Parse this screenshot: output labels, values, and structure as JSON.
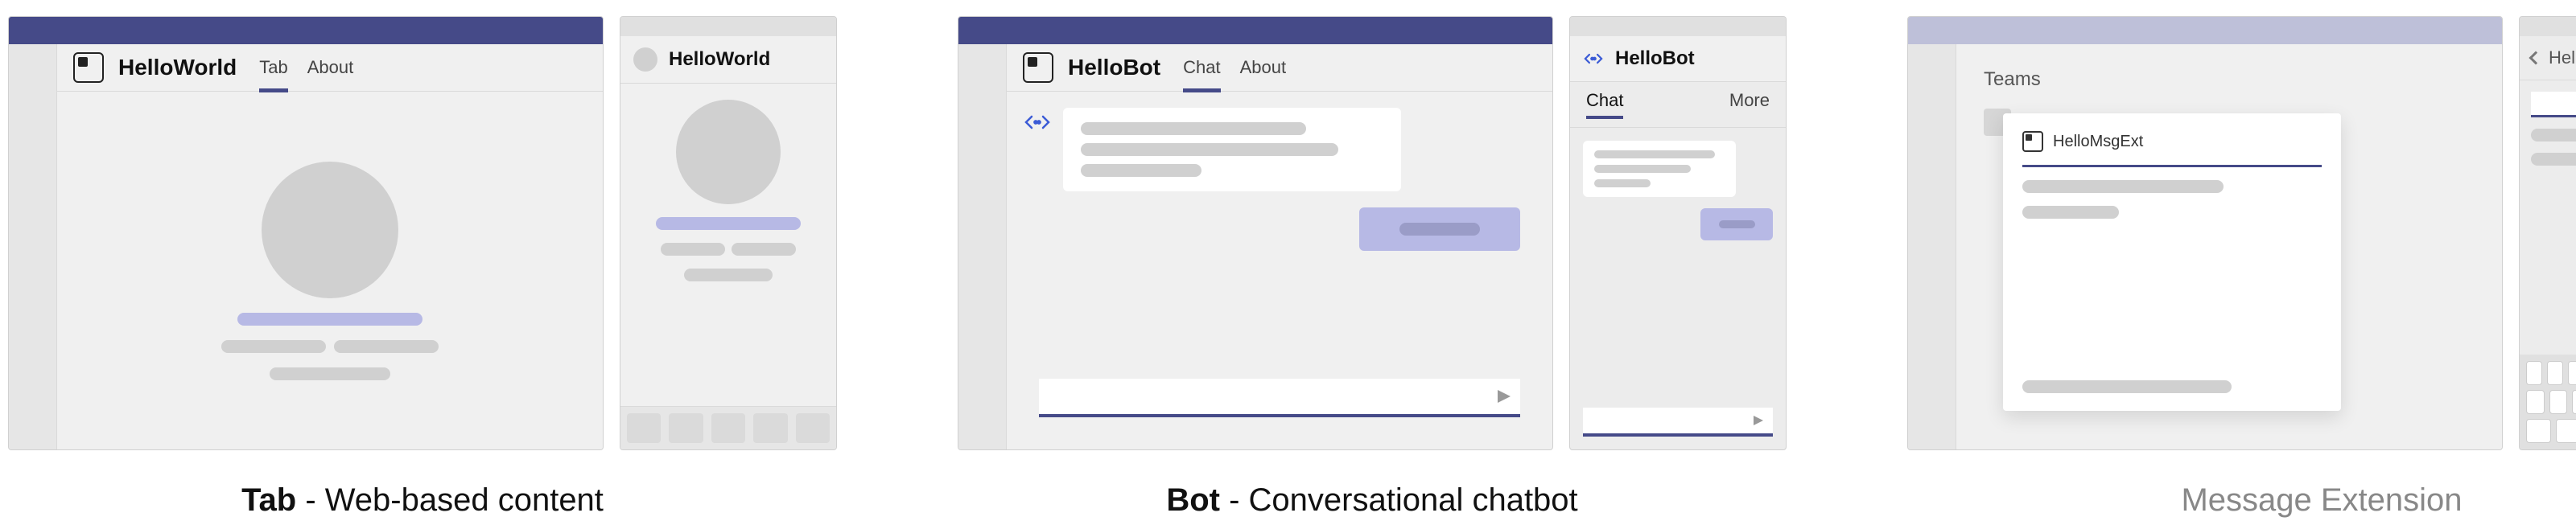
{
  "tab_group": {
    "app_name": "HelloWorld",
    "tabs": [
      "Tab",
      "About"
    ],
    "mobile_title": "HelloWorld",
    "caption_bold": "Tab",
    "caption_rest": " - Web-based content"
  },
  "bot_group": {
    "app_name": "HelloBot",
    "tabs": [
      "Chat",
      "About"
    ],
    "mobile_title": "HelloBot",
    "mobile_tabs": {
      "chat": "Chat",
      "more": "More"
    },
    "caption_bold": "Bot",
    "caption_rest": " - Conversational chatbot"
  },
  "ext_group": {
    "teams_label": "Teams",
    "card_title": "HelloMsgExt",
    "mobile_title": "HelloMsgExt",
    "caption": "Message Extension"
  }
}
